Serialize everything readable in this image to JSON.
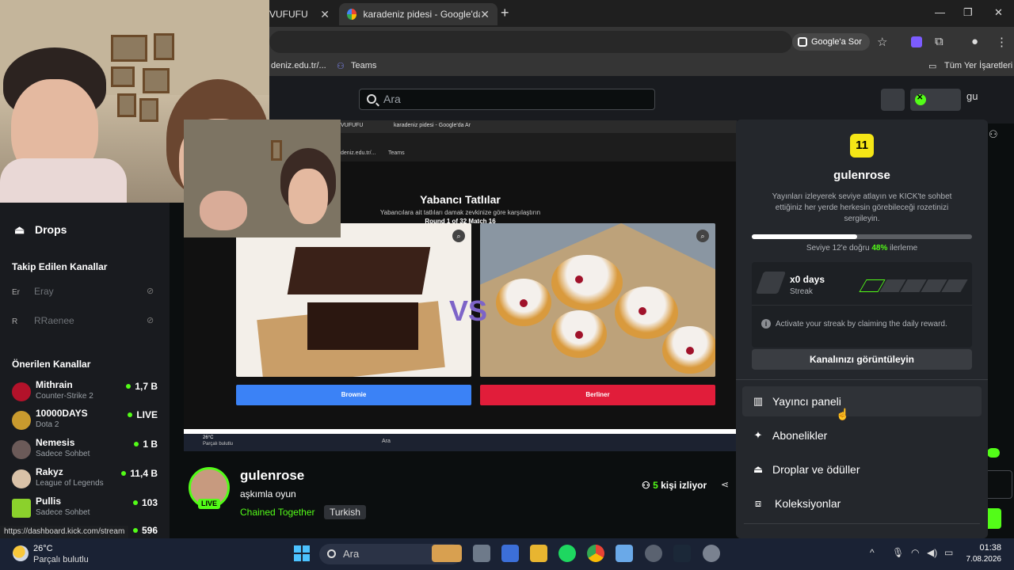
{
  "browser": {
    "tabs": [
      {
        "title": "VUFUFU"
      },
      {
        "title": "karadeniz pidesi - Google'da Ar"
      }
    ],
    "google_btn": "Google'a Sor",
    "bookmarks": [
      {
        "label": "deniz.edu.tr/..."
      },
      {
        "label": "Teams"
      }
    ],
    "all_bookmarks": "Tüm Yer İşaretleri"
  },
  "site": {
    "search_placeholder": "Ara",
    "avatar_alt": "gu",
    "sidebar": {
      "drops_label": "Drops",
      "followed_heading": "Takip Edilen Kanallar",
      "followed": [
        {
          "alt": "Er",
          "name": "Eray"
        },
        {
          "alt": "R",
          "name": "RRaenee"
        }
      ],
      "recommended_heading": "Önerilen Kanallar",
      "recommended": [
        {
          "name": "Mithrain",
          "category": "Counter-Strike 2",
          "count": "1,7 B",
          "color": "#b3122a"
        },
        {
          "name": "10000DAYS",
          "category": "Dota 2",
          "count": "LIVE",
          "color": "#c99a2e"
        },
        {
          "name": "Nemesis",
          "category": "Sadece Sohbet",
          "count": "1 B",
          "color": "#6b5a58"
        },
        {
          "name": "Rakyz",
          "category": "League of Legends",
          "count": "11,4 B",
          "color": "#d9c2a8"
        },
        {
          "name": "Pullis",
          "category": "Sadece Sohbet",
          "count": "103",
          "color": "#8bd12c"
        },
        {
          "name": "",
          "category": "",
          "count": "596",
          "color": "#444"
        }
      ]
    },
    "video": {
      "inner_tab1": "VUFUFU",
      "inner_tab2": "karadeniz pidesi - Google'da Ar",
      "inner_bookmark": "Teams",
      "inner_bookmark0": "deniz.edu.tr/...",
      "title": "Yabancı Tatlılar",
      "subtitle": "Yabancılara ait tatlıları damak zevkinize göre karşılaştırın",
      "round": "Round 1 of 32 Match 16",
      "vs": "VS",
      "left_choice": "Brownie",
      "right_choice": "Berliner",
      "inner_temp": "26°C",
      "inner_weather": "Parçalı bulutlu",
      "inner_search": "Ara"
    },
    "stream": {
      "streamer": "gulenrose",
      "live": "LIVE",
      "title": "aşkımla oyun",
      "category": "Chained Together",
      "tag": "Turkish",
      "viewers_num": "5",
      "viewers_label": "kişi izliyor"
    },
    "panel": {
      "level": "11",
      "username": "gulenrose",
      "description": "Yayınları izleyerek seviye atlayın ve KICK'te sohbet ettiğiniz her yerde herkesin görebileceği rozetinizi sergileyin.",
      "progress_percent": 48,
      "progress_prefix": "Seviye 12'e doğru",
      "progress_pct_label": "48%",
      "progress_suffix": "ilerleme",
      "streak_days": "x0 days",
      "streak_label": "Streak",
      "streak_info": "Activate your streak by claiming the daily reward.",
      "view_channel": "Kanalınızı görüntüleyin",
      "menu": [
        {
          "label": "Yayıncı paneli",
          "icon": "dashboard-icon"
        },
        {
          "label": "Abonelikler",
          "icon": "sparkle-icon"
        },
        {
          "label": "Droplar ve ödüller",
          "icon": "drops-icon"
        },
        {
          "label": "Koleksiyonlar",
          "icon": "collection-icon"
        }
      ]
    }
  },
  "status_url": "https://dashboard.kick.com/stream",
  "taskbar": {
    "temp": "26°C",
    "weather": "Parçalı bulutlu",
    "search": "Ara",
    "time": "01:38",
    "date": "7.08.2026"
  }
}
